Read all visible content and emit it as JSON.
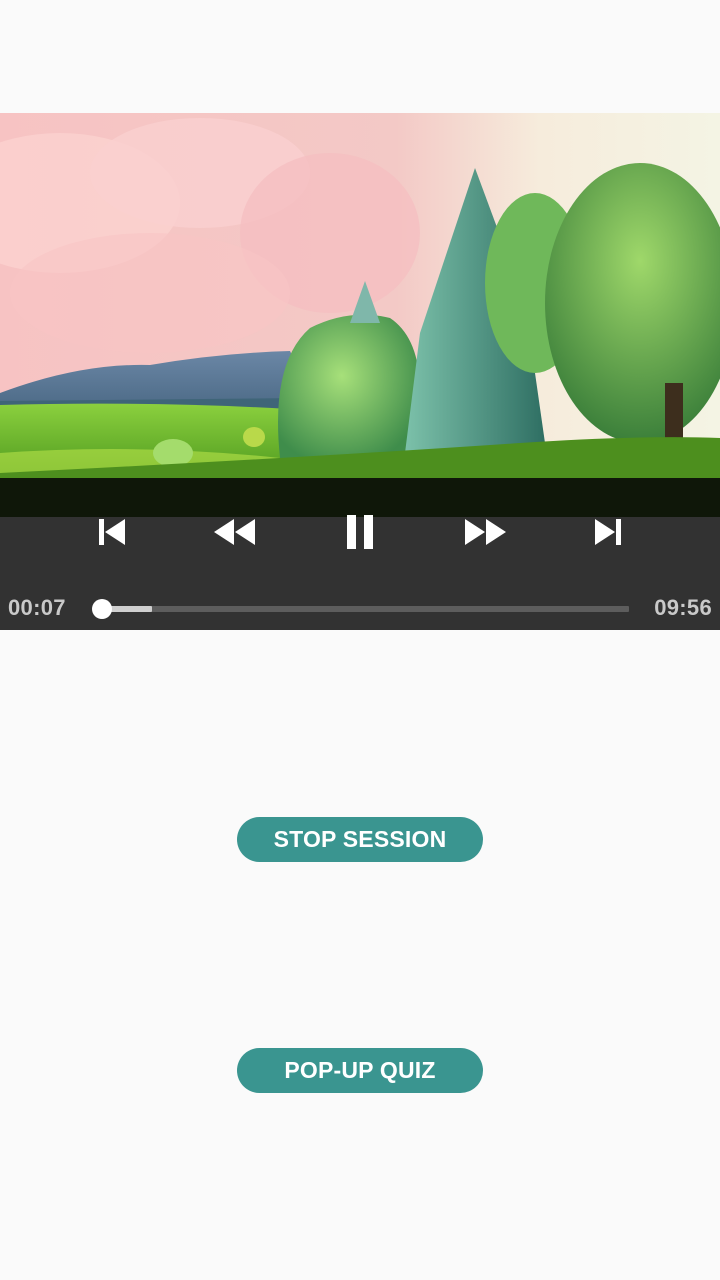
{
  "player": {
    "current_time": "00:07",
    "total_time": "09:56",
    "progress_fraction": 0.012,
    "buffered_fraction": 0.105,
    "state": "playing",
    "controls": [
      "previous-icon",
      "rewind-icon",
      "pause-icon",
      "fast-forward-icon",
      "next-icon"
    ]
  },
  "buttons": {
    "stop_session": "STOP SESSION",
    "popup_quiz": "POP-UP QUIZ"
  },
  "colors": {
    "accent": "#3a9590",
    "controls_bg": "#323232",
    "background": "#fafafa"
  }
}
